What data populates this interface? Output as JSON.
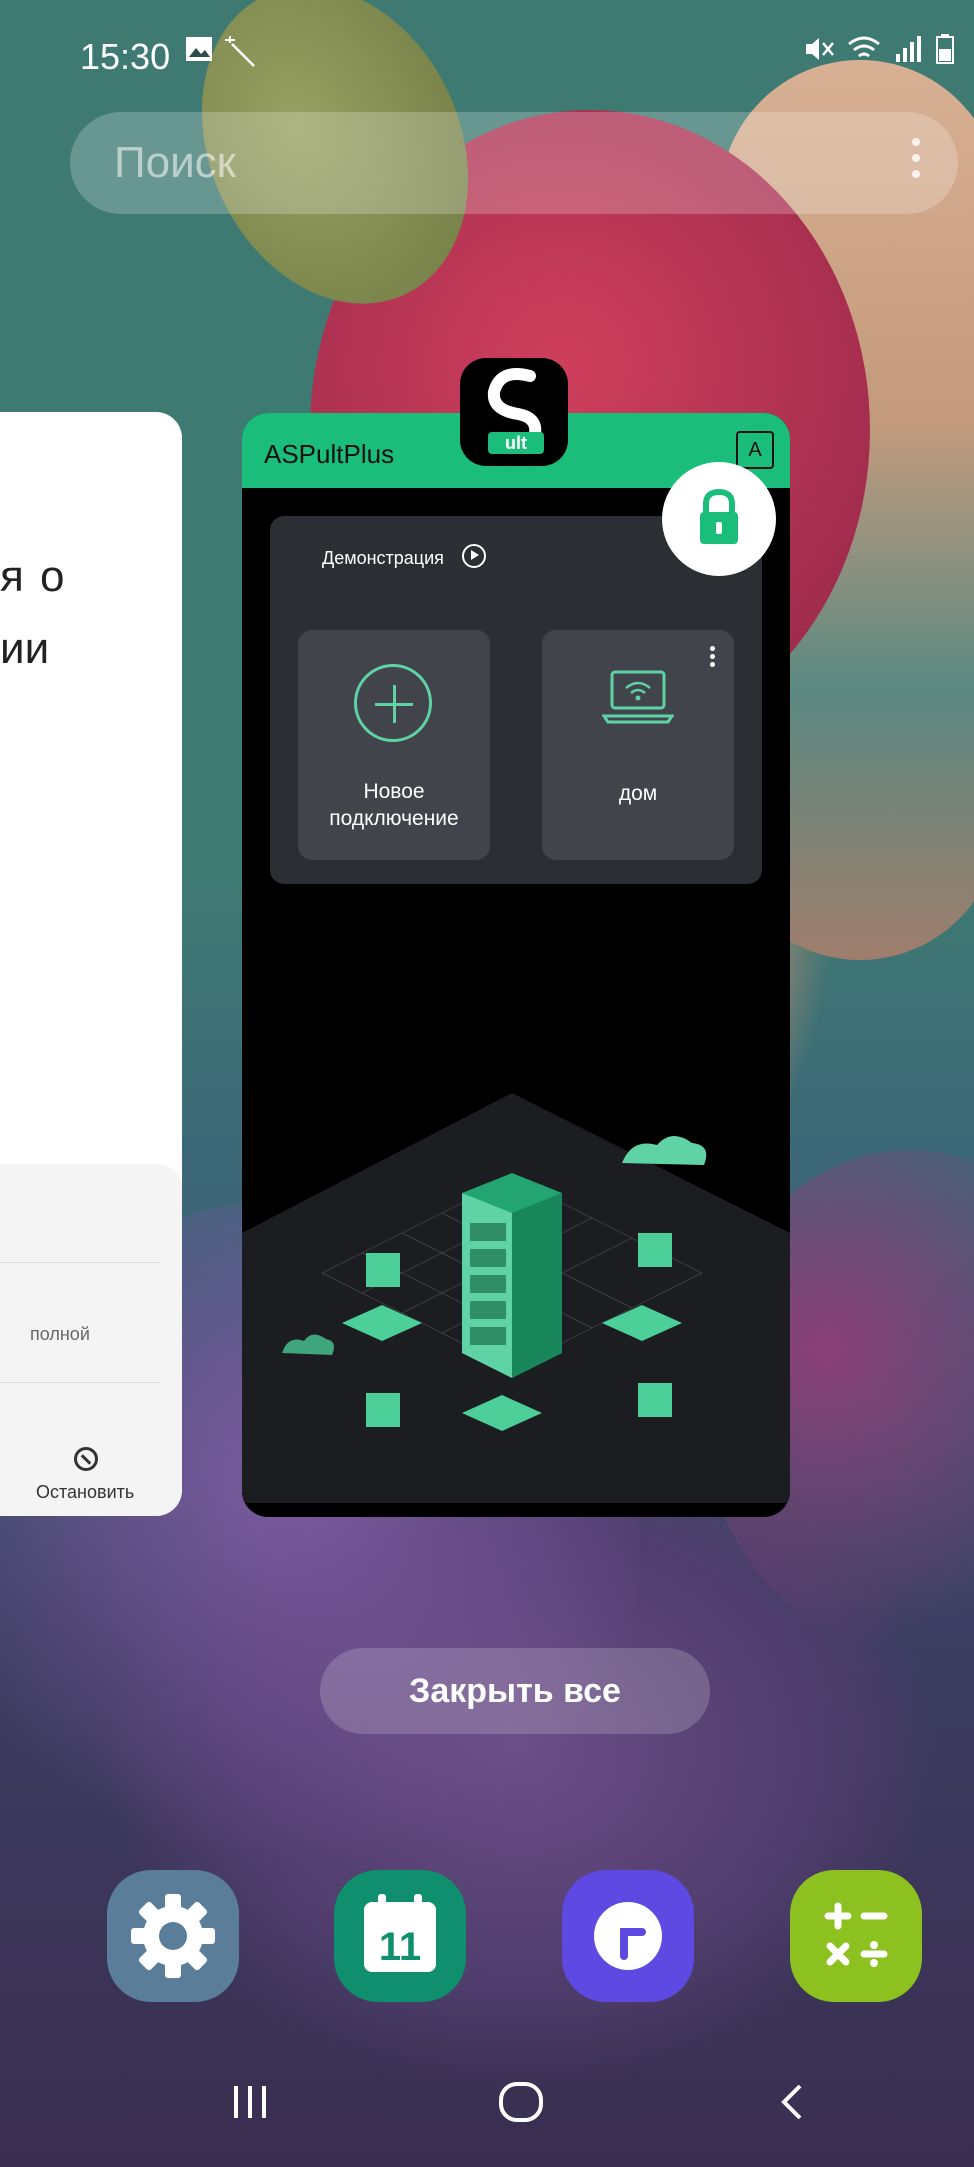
{
  "status_bar": {
    "time": "15:30",
    "left_icons": [
      "image-icon",
      "magic-wand-icon"
    ],
    "right_icons": [
      "mute-icon",
      "wifi-icon",
      "signal-icon",
      "battery-icon"
    ]
  },
  "search": {
    "placeholder": "Поиск"
  },
  "recent_left_card": {
    "text_line_1": "я о",
    "text_line_2": "ии",
    "item_text": "полной",
    "stop_label": "Остановить"
  },
  "recent_app_card": {
    "title": "ASPultPlus",
    "demo_label": "Демонстрация",
    "tiles": [
      {
        "label_line_1": "Новое",
        "label_line_2": "подключение",
        "icon": "plus-circle-icon"
      },
      {
        "label_line_1": "дом",
        "label_line_2": "",
        "icon": "laptop-wifi-icon"
      }
    ],
    "app_icon_text": "ult"
  },
  "close_all_label": "Закрыть все",
  "dock": [
    {
      "name": "settings",
      "color": "#5a7d9a"
    },
    {
      "name": "calendar",
      "text": "11",
      "color": "#0f8f6d"
    },
    {
      "name": "clock",
      "color": "#5e4ae3"
    },
    {
      "name": "calculator",
      "color": "#8cc11f"
    }
  ],
  "nav": [
    "recents-icon",
    "home-icon",
    "back-icon"
  ]
}
